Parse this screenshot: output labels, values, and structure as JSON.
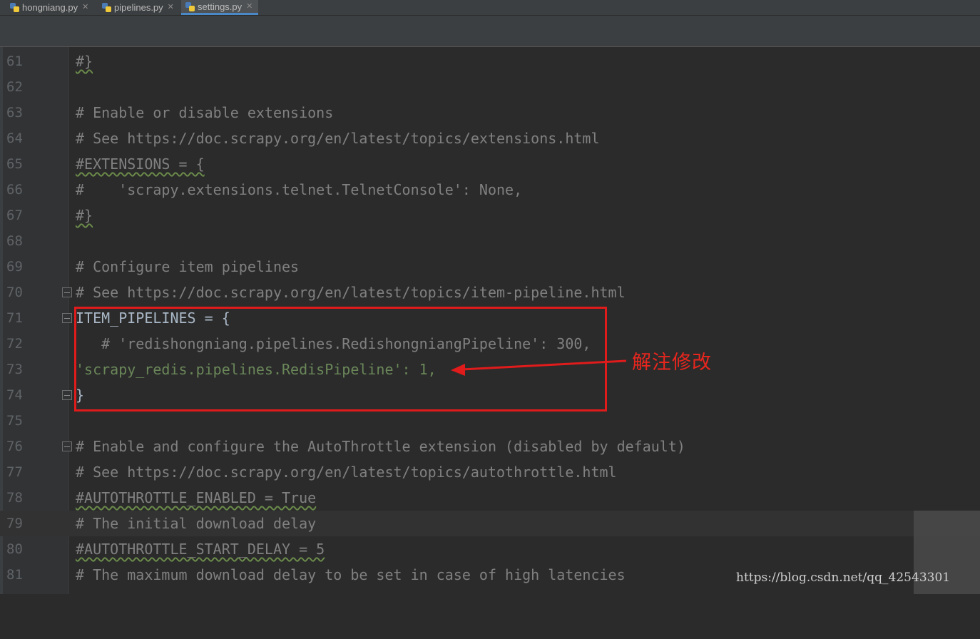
{
  "tabs": [
    {
      "label": "hongniang.py"
    },
    {
      "label": "pipelines.py"
    },
    {
      "label": "settings.py"
    }
  ],
  "editor": {
    "lines": [
      {
        "n": "61",
        "text": "#}"
      },
      {
        "n": "62",
        "text": ""
      },
      {
        "n": "63",
        "text": "# Enable or disable extensions"
      },
      {
        "n": "64",
        "text": "# See https://doc.scrapy.org/en/latest/topics/extensions.html"
      },
      {
        "n": "65",
        "text": "#EXTENSIONS = {"
      },
      {
        "n": "66",
        "text": "#    'scrapy.extensions.telnet.TelnetConsole': None,"
      },
      {
        "n": "67",
        "text": "#}"
      },
      {
        "n": "68",
        "text": ""
      },
      {
        "n": "69",
        "text": "# Configure item pipelines"
      },
      {
        "n": "70",
        "text": "# See https://doc.scrapy.org/en/latest/topics/item-pipeline.html"
      },
      {
        "n": "71",
        "text": "ITEM_PIPELINES = {"
      },
      {
        "n": "72",
        "text": "   # 'redishongniang.pipelines.RedishongniangPipeline': 300,"
      },
      {
        "n": "73",
        "text": "'scrapy_redis.pipelines.RedisPipeline': 1,"
      },
      {
        "n": "74",
        "text": "}"
      },
      {
        "n": "75",
        "text": ""
      },
      {
        "n": "76",
        "text": "# Enable and configure the AutoThrottle extension (disabled by default)"
      },
      {
        "n": "77",
        "text": "# See https://doc.scrapy.org/en/latest/topics/autothrottle.html"
      },
      {
        "n": "78",
        "text": "#AUTOTHROTTLE_ENABLED = True"
      },
      {
        "n": "79",
        "text": "# The initial download delay"
      },
      {
        "n": "80",
        "text": "#AUTOTHROTTLE_START_DELAY = 5"
      },
      {
        "n": "81",
        "text": "# The maximum download delay to be set in case of high latencies"
      }
    ],
    "current_line": "79"
  },
  "annotation": {
    "label": "解注修改",
    "color": "#e01b1b"
  },
  "watermark": "https://blog.csdn.net/qq_42543301",
  "colors": {
    "background": "#2b2b2b",
    "comment": "#808080",
    "string": "#6a8759",
    "number": "#6897bb",
    "keyword": "#cc7832",
    "text": "#a9b7c6"
  }
}
